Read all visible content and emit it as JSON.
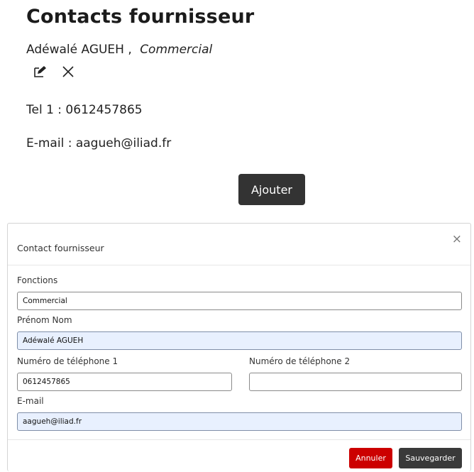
{
  "page": {
    "title": "Contacts fournisseur"
  },
  "contact": {
    "name": "Adéwalé AGUEH ,",
    "role": "Commercial",
    "tel_line": "Tel 1 : 0612457865",
    "email_line": "E-mail : aagueh@iliad.fr",
    "icons": [
      "edit-icon",
      "delete-icon"
    ]
  },
  "add_button": "Ajouter",
  "modal": {
    "title": "Contact fournisseur",
    "close_glyph": "×",
    "fields": {
      "fonctions": {
        "label": "Fonctions",
        "value": "Commercial"
      },
      "prenom_nom": {
        "label": "Prénom Nom",
        "value": "Adéwalé AGUEH"
      },
      "tel1": {
        "label": "Numéro de téléphone 1",
        "value": "0612457865"
      },
      "tel2": {
        "label": "Numéro de téléphone 2",
        "value": ""
      },
      "email": {
        "label": "E-mail",
        "value": "aagueh@iliad.fr"
      }
    },
    "buttons": {
      "cancel": "Annuler",
      "save": "Sauvegarder"
    }
  },
  "colors": {
    "add_button_bg": "#333333",
    "cancel_bg": "#cc0000",
    "save_bg": "#3a3a3a",
    "autofill_bg": "#e8f0fe"
  }
}
